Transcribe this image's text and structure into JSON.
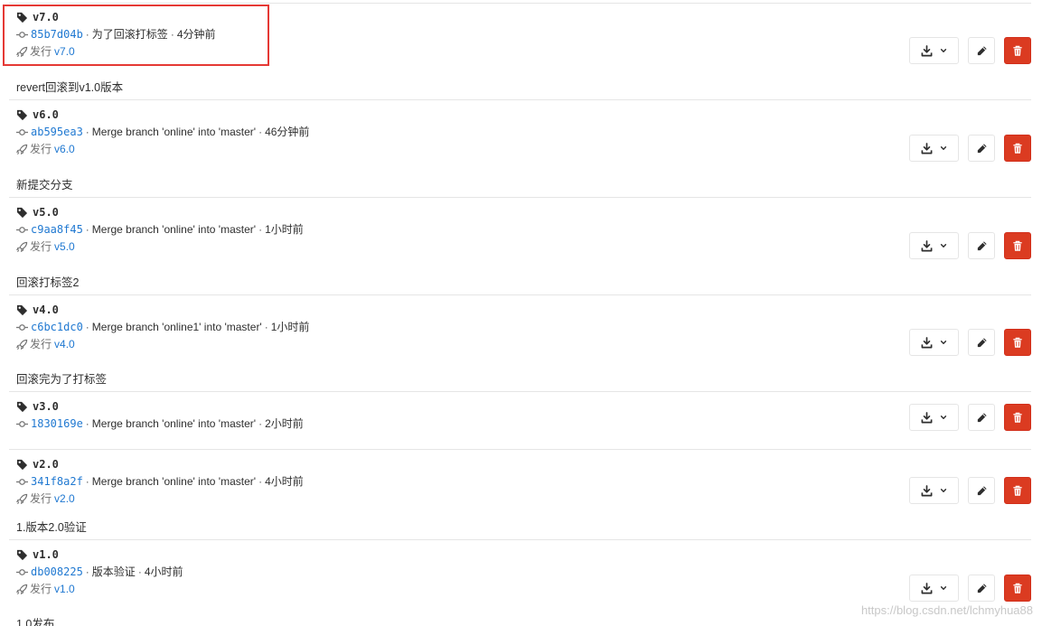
{
  "release_prefix": "发行",
  "separator": "·",
  "tags": [
    {
      "name": "v7.0",
      "sha": "85b7d04b",
      "message": "为了回滚打标签",
      "time": "4分钟前",
      "release": "v7.0",
      "description": "revert回滚到v1.0版本"
    },
    {
      "name": "v6.0",
      "sha": "ab595ea3",
      "message": "Merge branch 'online' into 'master'",
      "time": "46分钟前",
      "release": "v6.0",
      "description": "新提交分支"
    },
    {
      "name": "v5.0",
      "sha": "c9aa8f45",
      "message": "Merge branch 'online' into 'master'",
      "time": "1小时前",
      "release": "v5.0",
      "description": "回滚打标签2"
    },
    {
      "name": "v4.0",
      "sha": "c6bc1dc0",
      "message": "Merge branch 'online1' into 'master'",
      "time": "1小时前",
      "release": "v4.0",
      "description": "回滚完为了打标签"
    },
    {
      "name": "v3.0",
      "sha": "1830169e",
      "message": "Merge branch 'online' into 'master'",
      "time": "2小时前"
    },
    {
      "name": "v2.0",
      "sha": "341f8a2f",
      "message": "Merge branch 'online' into 'master'",
      "time": "4小时前",
      "release": "v2.0",
      "description": "1.版本2.0验证"
    },
    {
      "name": "v1.0",
      "sha": "db008225",
      "message": "版本验证",
      "time": "4小时前",
      "release": "v1.0",
      "description": "1.0发布"
    }
  ],
  "colors": {
    "link": "#1f78d1",
    "delete_button": "#db3b21",
    "highlight_border": "#e53935",
    "divider": "#e5e5e5"
  },
  "icons": {
    "tag": "tag-icon",
    "commit": "commit-icon",
    "release": "rocket-icon",
    "download": "download-icon",
    "dropdown": "chevron-down-icon",
    "edit": "pencil-icon",
    "delete": "trash-icon"
  },
  "watermark": "https://blog.csdn.net/lchmyhua88"
}
